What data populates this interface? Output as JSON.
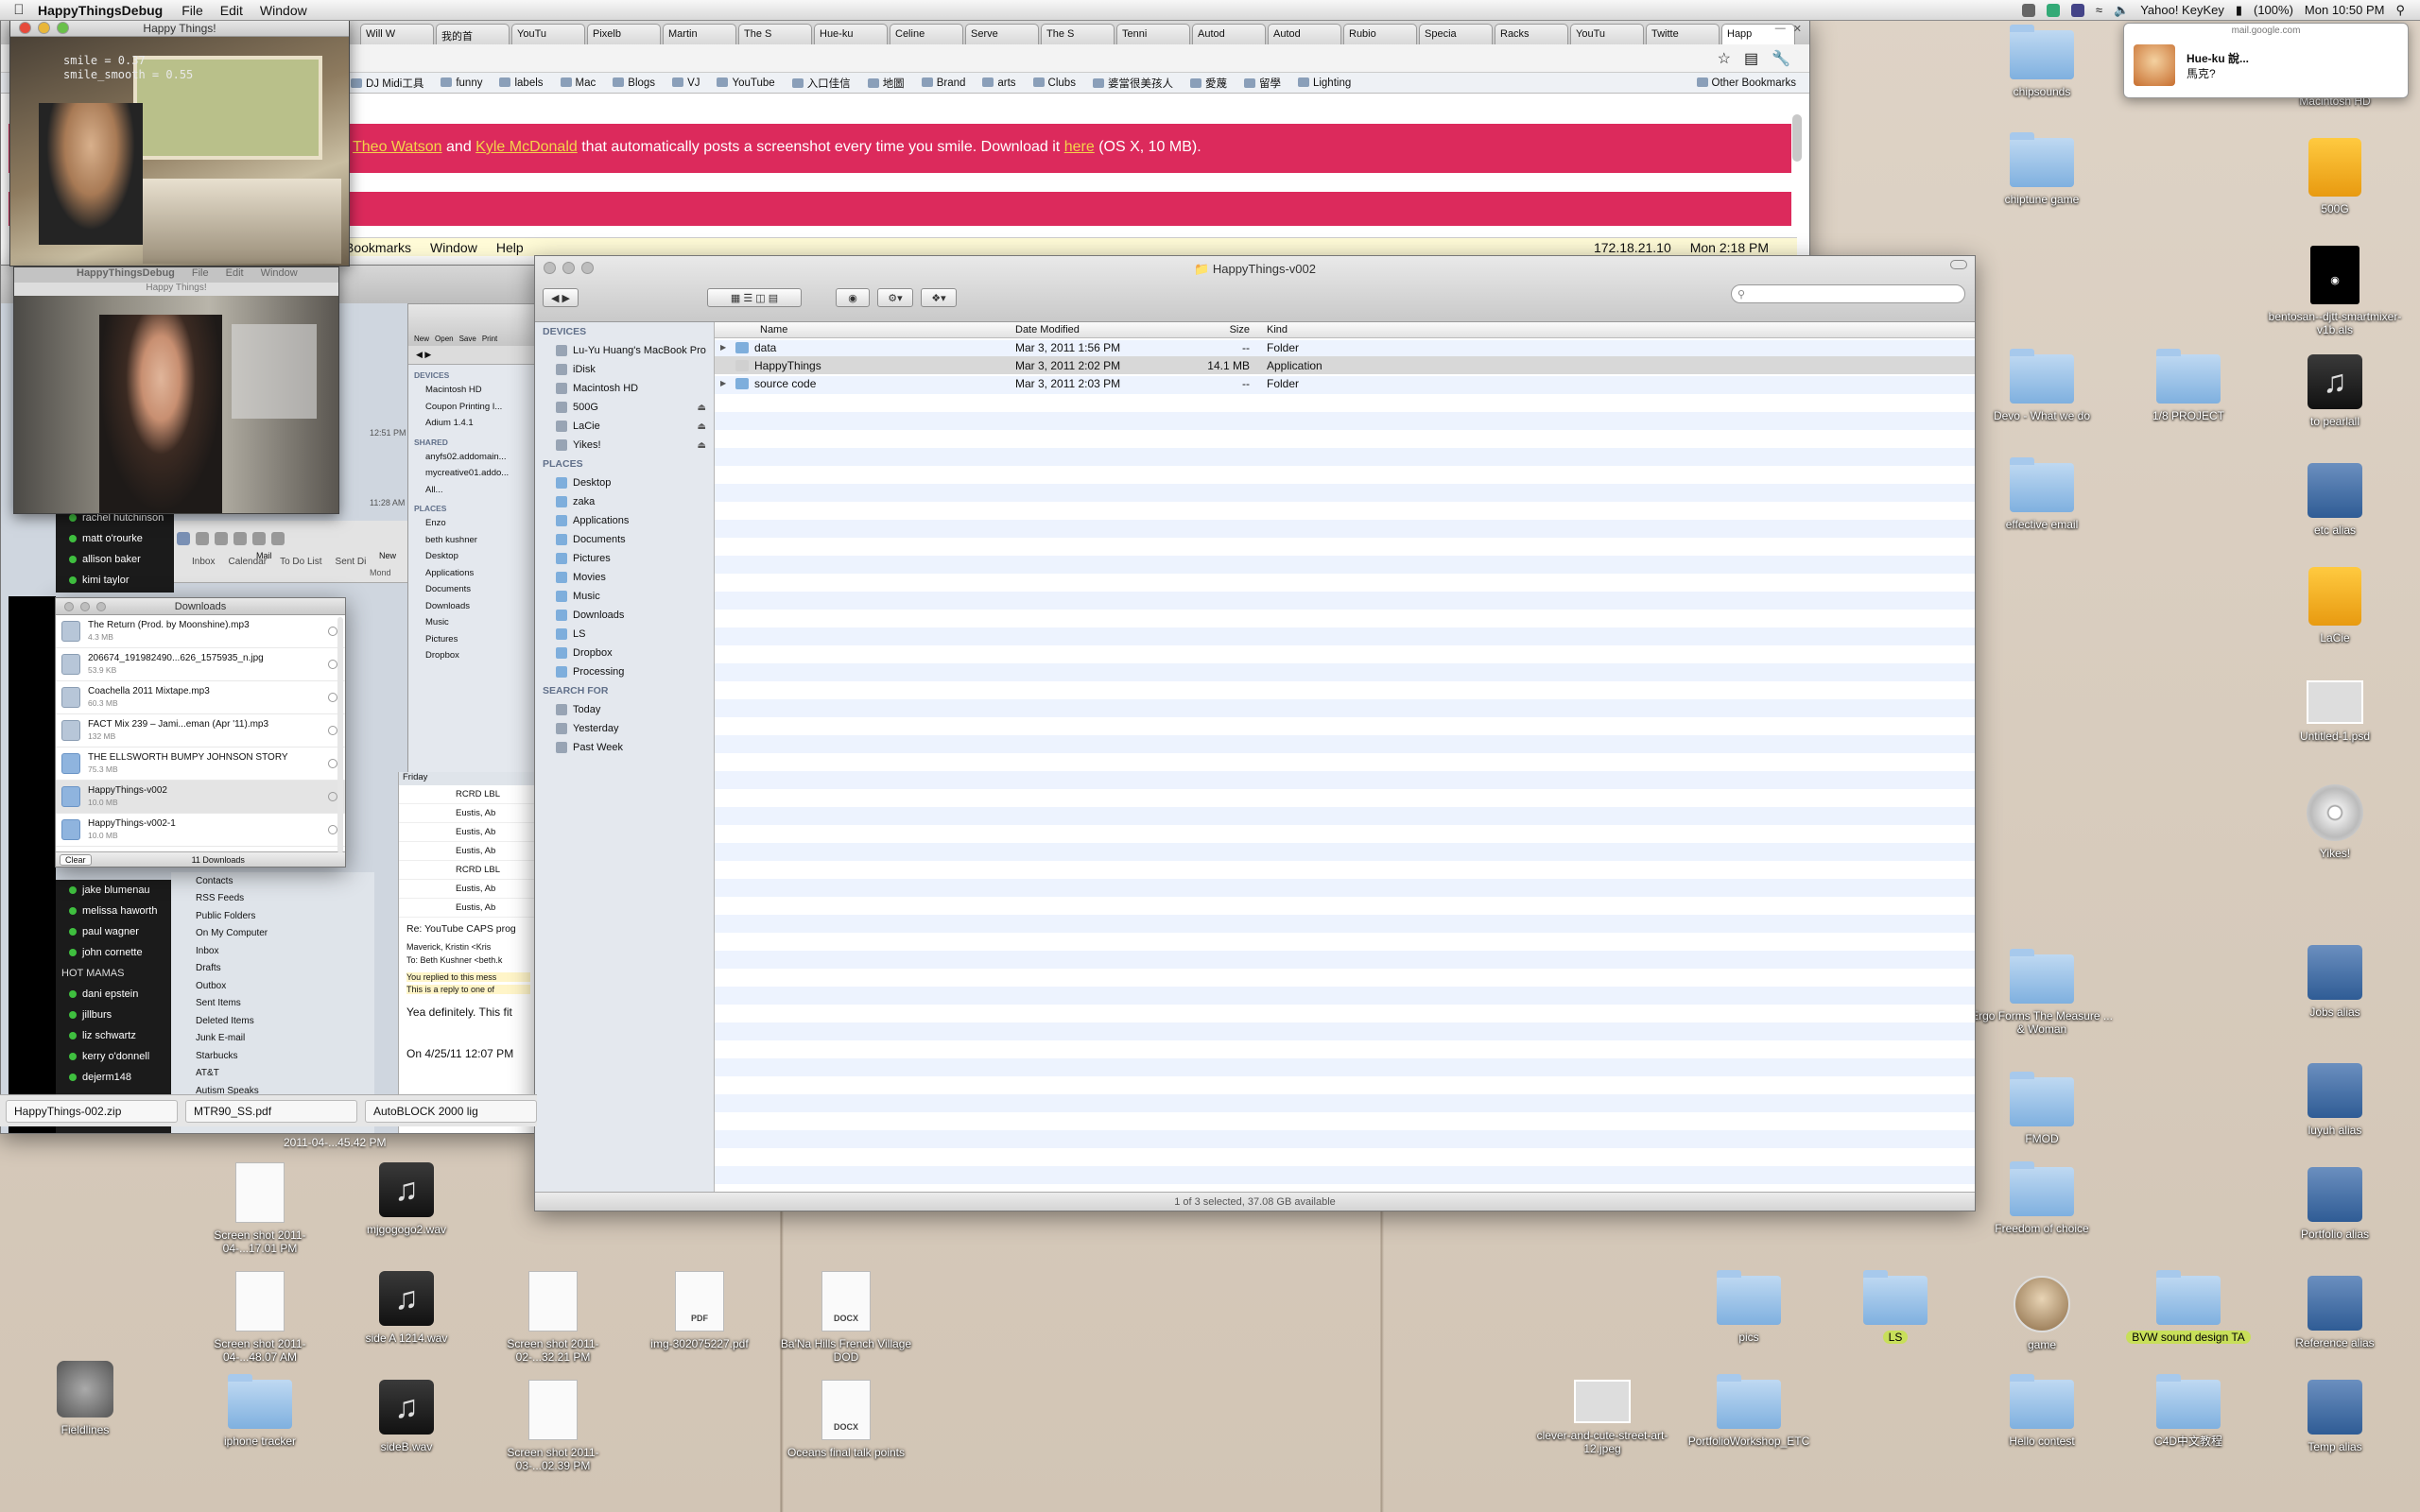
{
  "menubar": {
    "app": "HappyThingsDebug",
    "items": [
      "File",
      "Edit",
      "Window"
    ],
    "status": {
      "battery": "(100%)",
      "keyboard": "Yahoo! KeyKey",
      "clock": "Mon 10:50 PM"
    }
  },
  "browser": {
    "tabs": [
      "Will W",
      "我的首",
      "YouTu",
      "Pixelb",
      "Martin",
      "The S",
      "Hue-ku",
      "Celine",
      "Serve",
      "The S",
      "Tenni",
      "Autod",
      "Autod",
      "Rubio",
      "Specia",
      "Racks",
      "YouTu",
      "Twitte",
      "Happ"
    ],
    "bookmarks": [
      "DJ Midi工具",
      "funny",
      "labels",
      "Mac",
      "Blogs",
      "VJ",
      "YouTube",
      "入口佳信",
      "地圖",
      "Brand",
      "arts",
      "Clubs",
      "婆當很美孩人",
      "愛蔑",
      "留學",
      "Lighting"
    ],
    "other_bookmarks": "Other Bookmarks",
    "banner": {
      "author1": "Theo Watson",
      "and": "and",
      "author2": "Kyle McDonald",
      "text": "that automatically posts a screenshot every time you smile. Download it",
      "link": "here",
      "tail": "(OS X, 10 MB)."
    },
    "innerbar": {
      "items": [
        "Bookmarks",
        "Window",
        "Help"
      ],
      "ip": "172.18.21.10",
      "clock": "Mon 2:18 PM"
    }
  },
  "cam1": {
    "title": "Happy Things!",
    "smile": "smile = 0.37",
    "smile_smooth": "smile_smooth = 0.55"
  },
  "cam2": {
    "title": "Happy Things!",
    "app": "HappyThingsDebug",
    "menu": [
      "File",
      "Edit",
      "Window"
    ]
  },
  "mail": {
    "tabs": [
      "Inbox",
      "Calendar",
      "To Do List",
      "Sent Di"
    ],
    "labels": [
      "Mail",
      "New"
    ],
    "folders": [
      "Contacts",
      "RSS Feeds",
      "Public Folders",
      "On My Computer",
      "Inbox",
      "Drafts",
      "Outbox",
      "Sent Items",
      "Deleted Items",
      "Junk E-mail",
      "Starbucks",
      "AT&T",
      "Autism Speaks"
    ],
    "message": {
      "subject": "Re: YouTube CAPS prog",
      "from": "Maverick, Kristin <Kris",
      "to": "To: Beth Kushner <beth.k",
      "replied": "You replied to this mess",
      "reply_to": "This is a reply to one of",
      "body": "Yea definitely. This fit",
      "quote": "On 4/25/11 12:07 PM"
    },
    "rows": [
      "RCRD LBL",
      "Eustis, Ab",
      "Eustis, Ab",
      "Eustis, Ab",
      "RCRD LBL",
      "Eustis, Ab",
      "Eustis, Ab"
    ],
    "friday": "Friday",
    "times": [
      "12:51 PM",
      "11:28 AM",
      "Mond"
    ]
  },
  "chat": {
    "buddies_top": [
      "rachel hutchinson",
      "matt o'rourke",
      "allison baker",
      "kimi taylor"
    ],
    "buddies": [
      "jake blumenau",
      "melissa haworth",
      "paul wagner",
      "john cornette",
      "HOT MAMAS",
      "dani epstein",
      "jillburs",
      "liz schwartz",
      "kerry o'donnell",
      "dejerm148"
    ]
  },
  "smallfinder": {
    "tools": [
      "New",
      "Open",
      "Save",
      "Print"
    ],
    "devices_h": "DEVICES",
    "devices": [
      "Macintosh HD",
      "Coupon Printing I...",
      "Adium 1.4.1"
    ],
    "shared_h": "SHARED",
    "shared": [
      "anyfs02.addomain...",
      "mycreative01.addo...",
      "All..."
    ],
    "places_h": "PLACES",
    "places": [
      "Enzo",
      "beth kushner",
      "Desktop",
      "Applications",
      "Documents",
      "Downloads",
      "Music",
      "Pictures",
      "Dropbox"
    ]
  },
  "downloads": {
    "title": "Downloads",
    "items": [
      {
        "name": "The Return (Prod. by Moonshine).mp3",
        "size": "4.3 MB"
      },
      {
        "name": "206674_191982490...626_1575935_n.jpg",
        "size": "53.9 KB"
      },
      {
        "name": "Coachella 2011 Mixtape.mp3",
        "size": "60.3 MB"
      },
      {
        "name": "FACT Mix 239 – Jami...eman (Apr '11).mp3",
        "size": "132 MB"
      },
      {
        "name": "THE ELLSWORTH BUMPY JOHNSON STORY",
        "size": "75.3 MB"
      },
      {
        "name": "HappyThings-v002",
        "size": "10.0 MB"
      },
      {
        "name": "HappyThings-v002-1",
        "size": "10.0 MB"
      }
    ],
    "clear": "Clear",
    "count": "11 Downloads"
  },
  "finder": {
    "title": "HappyThings-v002",
    "sidebar": {
      "devices_h": "DEVICES",
      "devices": [
        "Lu-Yu Huang's MacBook Pro",
        "iDisk",
        "Macintosh HD",
        "500G",
        "LaCie",
        "Yikes!"
      ],
      "places_h": "PLACES",
      "places": [
        "Desktop",
        "zaka",
        "Applications",
        "Documents",
        "Pictures",
        "Movies",
        "Music",
        "Downloads",
        "LS",
        "Dropbox",
        "Processing"
      ],
      "search_h": "SEARCH FOR",
      "search": [
        "Today",
        "Yesterday",
        "Past Week"
      ]
    },
    "columns": [
      "Name",
      "Date Modified",
      "Size",
      "Kind"
    ],
    "rows": [
      {
        "name": "data",
        "date": "Mar 3, 2011 1:56 PM",
        "size": "--",
        "kind": "Folder"
      },
      {
        "name": "HappyThings",
        "date": "Mar 3, 2011 2:02 PM",
        "size": "14.1 MB",
        "kind": "Application"
      },
      {
        "name": "source code",
        "date": "Mar 3, 2011 2:03 PM",
        "size": "--",
        "kind": "Folder"
      }
    ],
    "status": "1 of 3 selected, 37.08 GB available"
  },
  "dlbar": [
    "HappyThings-002.zip",
    "MTR90_SS.pdf",
    "AutoBLOCK 2000 lig"
  ],
  "notification": {
    "source": "mail.google.com",
    "title": "Hue-ku 說...",
    "body": "馬克?"
  },
  "desktop": {
    "below_window": "2011-04-...45.42 PM",
    "icons": [
      {
        "label": "chipsounds",
        "kind": "folder"
      },
      {
        "label": "chiptune game",
        "kind": "folder"
      },
      {
        "label": "Macintosh HD",
        "kind": "drive"
      },
      {
        "label": "500G",
        "kind": "drive"
      },
      {
        "label": "bentosan--djtt-smartmixer-v1b.als",
        "kind": "doc"
      },
      {
        "label": "Devo - What we do",
        "kind": "folder"
      },
      {
        "label": "1/8 PROJECT",
        "kind": "folder"
      },
      {
        "label": "to pearlall",
        "kind": "music"
      },
      {
        "label": "effective email",
        "kind": "folder"
      },
      {
        "label": "etc alias",
        "kind": "alias"
      },
      {
        "label": "LaCie",
        "kind": "drive"
      },
      {
        "label": "Untitled-1.psd",
        "kind": "image"
      },
      {
        "label": "Yikes!",
        "kind": "cd"
      },
      {
        "label": "Ergo Forms The Measure ... & Woman",
        "kind": "folder"
      },
      {
        "label": "Jobs alias",
        "kind": "alias"
      },
      {
        "label": "FMOD",
        "kind": "folder"
      },
      {
        "label": "luyuh alias",
        "kind": "alias"
      },
      {
        "label": "Freedom of choice",
        "kind": "folder"
      },
      {
        "label": "Portfolio alias",
        "kind": "alias"
      },
      {
        "label": "game",
        "kind": "zeus"
      },
      {
        "label": "BVW sound design TA",
        "kind": "folder"
      },
      {
        "label": "Reference alias",
        "kind": "alias"
      },
      {
        "label": "Hello contest",
        "kind": "folder"
      },
      {
        "label": "C4D中文教程",
        "kind": "folder"
      },
      {
        "label": "Temp alias",
        "kind": "alias"
      },
      {
        "label": "pics",
        "kind": "folder"
      },
      {
        "label": "LS",
        "kind": "folder"
      },
      {
        "label": "clever-and-cute-street-art-12.jpeg",
        "kind": "image"
      },
      {
        "label": "PortfolioWorkshop_ETC",
        "kind": "folder"
      },
      {
        "label": "Screen shot 2011-04-...17.01 PM",
        "kind": "doc"
      },
      {
        "label": "mjgogogo2.wav",
        "kind": "music"
      },
      {
        "label": "Screen shot 2011-04-...48.07 AM",
        "kind": "doc"
      },
      {
        "label": "side A 1214.wav",
        "kind": "music"
      },
      {
        "label": "Screen shot 2011-02-...32.21 PM",
        "kind": "doc"
      },
      {
        "label": "img-302075227.pdf",
        "kind": "pdf"
      },
      {
        "label": "Ba'Na Hills French Village DOD",
        "kind": "docx"
      },
      {
        "label": "Fieldlines",
        "kind": "app"
      },
      {
        "label": "iphone tracker",
        "kind": "folder"
      },
      {
        "label": "sideB.wav",
        "kind": "music"
      },
      {
        "label": "Screen shot 2011-03-...02.39 PM",
        "kind": "doc"
      },
      {
        "label": "Oceans final talk points",
        "kind": "docx"
      }
    ]
  }
}
